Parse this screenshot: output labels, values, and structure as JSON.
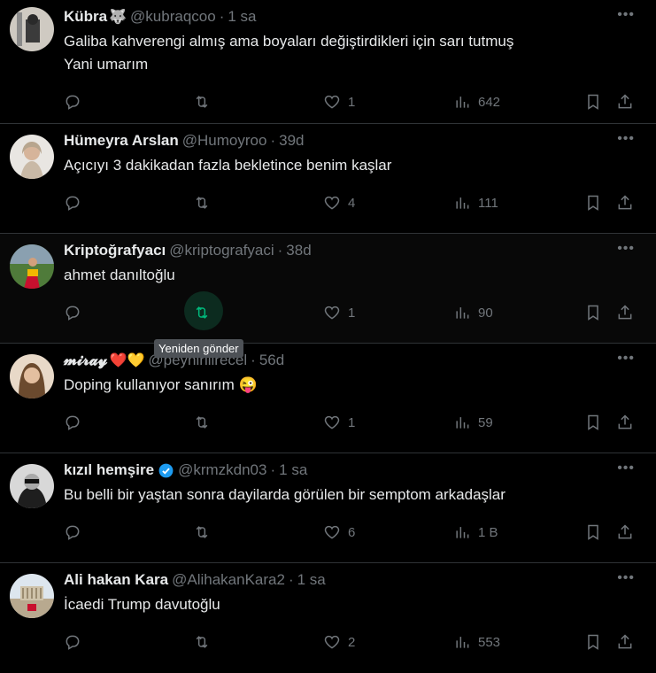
{
  "tweets": [
    {
      "name": "Kübra",
      "name_extra": "🐺",
      "handle": "@kubraqcoo",
      "time": "1 sa",
      "text_lines": [
        "Galiba kahverengi almış ama boyaları değiştirdikleri için sarı tutmuş",
        "Yani umarım"
      ],
      "likes": "1",
      "views": "642"
    },
    {
      "name": "Hümeyra Arslan",
      "handle": "@Humoyroo",
      "time": "39d",
      "text_lines": [
        "Açıcıyı 3 dakikadan fazla bekletince benim kaşlar"
      ],
      "likes": "4",
      "views": "111"
    },
    {
      "name": "Kriptoğrafyacı",
      "handle": "@kriptografyaci",
      "time": "38d",
      "text_lines": [
        "ahmet danıltoğlu"
      ],
      "likes": "1",
      "views": "90"
    },
    {
      "name": "𝓶𝓲𝓻𝓪𝔂",
      "name_extra": "❤️💛",
      "handle": "@peynirliirecel",
      "time": "56d",
      "text_lines": [
        "Doping kullanıyor sanırım 😜"
      ],
      "likes": "1",
      "views": "59"
    },
    {
      "name": "kızıl hemşire",
      "handle": "@krmzkdn03",
      "time": "1 sa",
      "text_lines": [
        "Bu belli bir yaştan sonra dayilarda görülen bir semptom arkadaşlar"
      ],
      "likes": "6",
      "views": "1 B"
    },
    {
      "name": "Ali hakan Kara",
      "handle": "@AlihakanKara2",
      "time": "1 sa",
      "text_lines": [
        "İcaedi Trump davutoğlu"
      ],
      "likes": "2",
      "views": "553"
    }
  ],
  "more_label": "•••",
  "dot": "·",
  "tooltip": "Yeniden gönder",
  "icons": {
    "reply": "reply-icon",
    "retweet": "retweet-icon",
    "like": "heart-icon",
    "views": "views-icon",
    "bookmark": "bookmark-icon",
    "share": "share-icon",
    "verified": "verified-badge-icon"
  },
  "colors": {
    "background": "#000000",
    "text": "#e7e9ea",
    "muted": "#71767b",
    "divider": "#2f3336",
    "retweet_active": "#00ba7c",
    "verified": "#1d9bf0"
  }
}
